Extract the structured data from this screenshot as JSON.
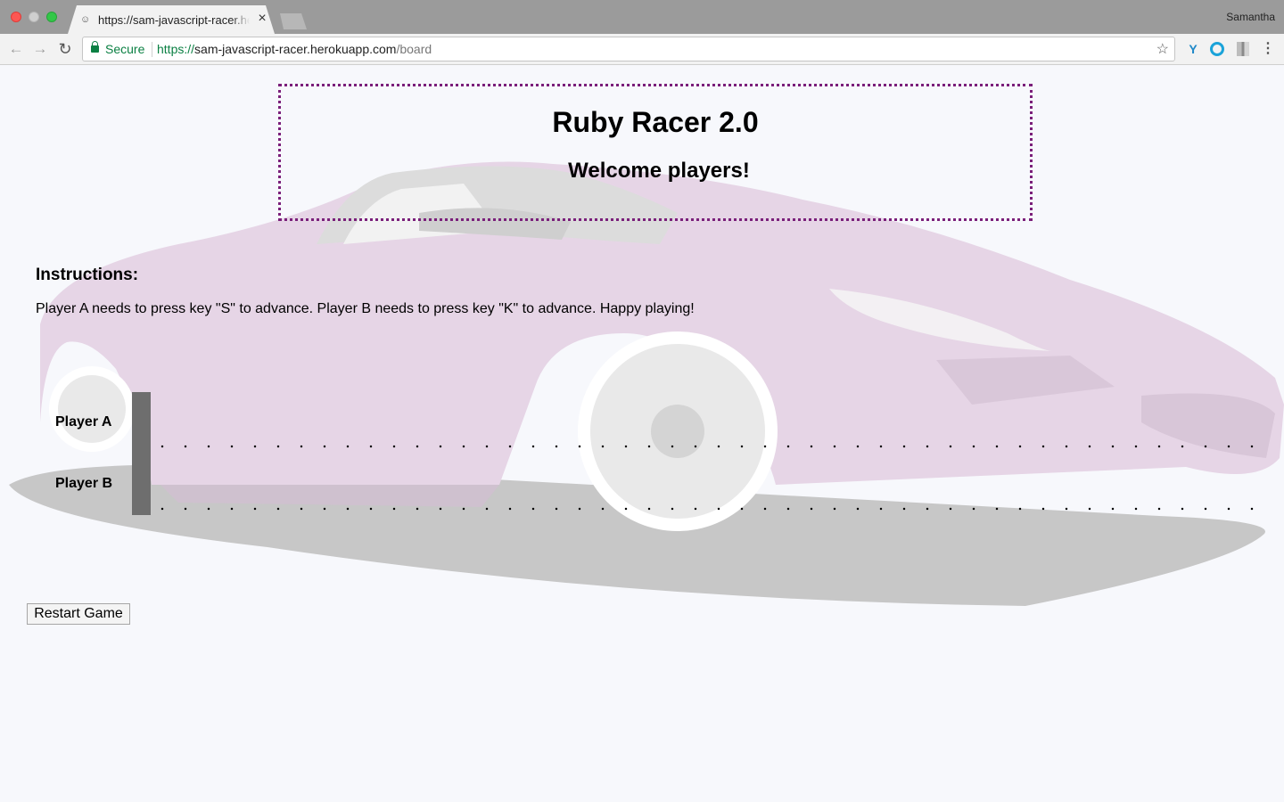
{
  "browser": {
    "tab_title": "https://sam-javascript-racer.herokuapp.com/board",
    "profile_name": "Samantha",
    "security_label": "Secure",
    "url_scheme": "https://",
    "url_host": "sam-javascript-racer.herokuapp.com",
    "url_path": "/board"
  },
  "page": {
    "title": "Ruby Racer 2.0",
    "subtitle": "Welcome players!",
    "instructions_heading": "Instructions:",
    "instructions_text": "Player A needs to press key \"S\" to advance. Player B needs to press key \"K\" to advance. Happy playing!",
    "players": [
      {
        "label": "Player A"
      },
      {
        "label": "Player B"
      }
    ],
    "restart_label": "Restart Game",
    "header_border_color": "#7a1f7a"
  }
}
